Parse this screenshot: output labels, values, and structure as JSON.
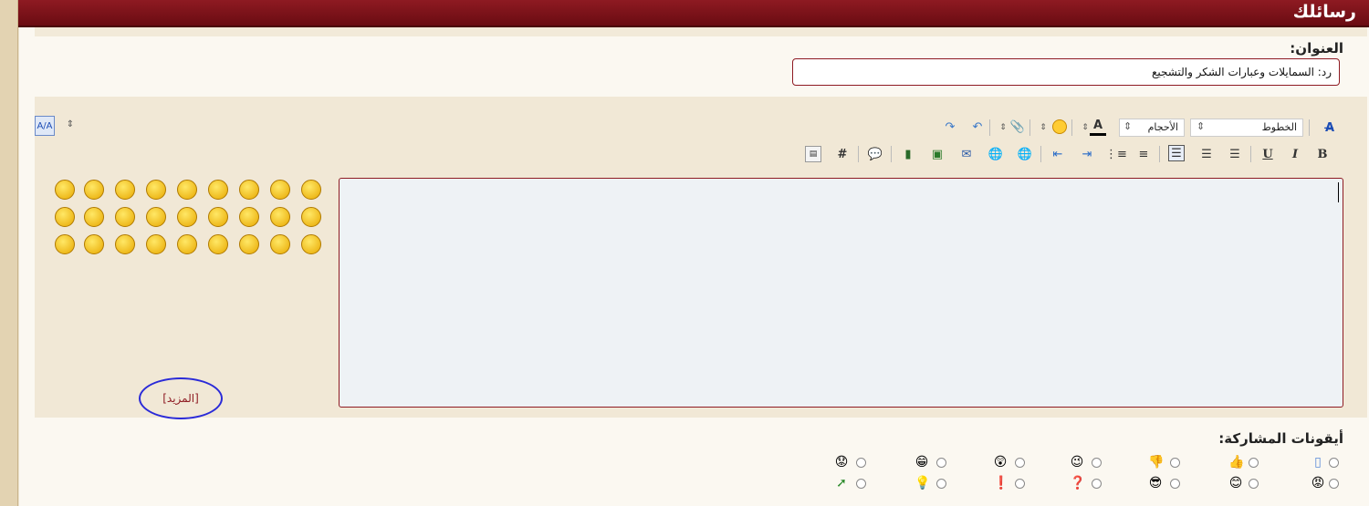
{
  "window": {
    "title": "رسائلك"
  },
  "subject": {
    "label": "العنوان:",
    "value": "رد: السمايلات وعبارات الشكر والتشجيع"
  },
  "toolbar": {
    "fonts_label": "الخطوط",
    "sizes_label": "الأحجام",
    "bold": "B",
    "italic": "I",
    "underline": "U"
  },
  "smilies": {
    "more_label": "[المزيد]"
  },
  "post_icons": {
    "label": "أيقونات المشاركة:"
  },
  "colors": {
    "accent": "#8e1a22",
    "link_outline": "#2a2ad8"
  }
}
